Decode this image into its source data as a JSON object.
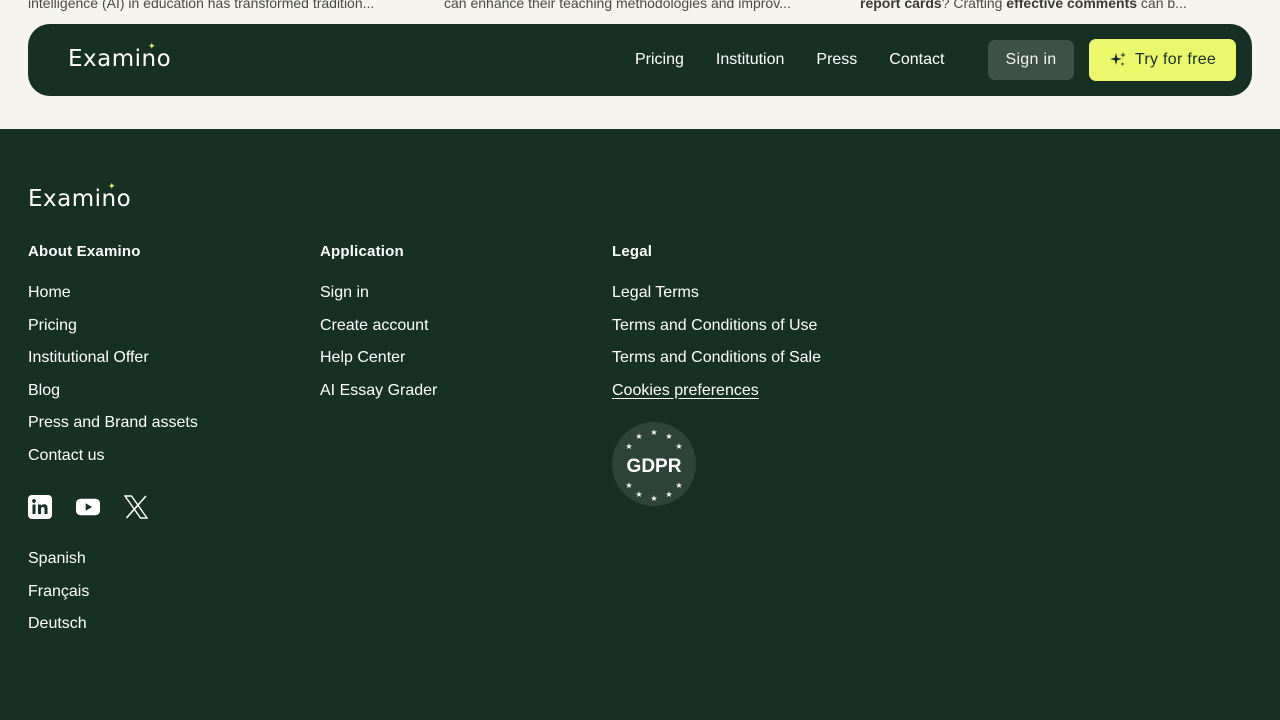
{
  "top_snippets": {
    "left": "intelligence (AI) in education has transformed tradition...",
    "middle": "can enhance their teaching methodologies and improv...",
    "right_bold1": "report cards",
    "right_mid": "? Crafting ",
    "right_bold2": "effective comments",
    "right_end": " can b..."
  },
  "brand": {
    "name": "Examino",
    "accent": "#ecf86b",
    "bg": "#163024"
  },
  "header": {
    "nav": [
      "Pricing",
      "Institution",
      "Press",
      "Contact"
    ],
    "signin_label": "Sign in",
    "try_label": "Try for free"
  },
  "footer": {
    "about": {
      "title": "About Examino",
      "links": [
        "Home",
        "Pricing",
        "Institutional Offer",
        "Blog",
        "Press and Brand assets",
        "Contact us"
      ]
    },
    "application": {
      "title": "Application",
      "links": [
        "Sign in",
        "Create account",
        "Help Center",
        "AI Essay Grader"
      ]
    },
    "legal": {
      "title": "Legal",
      "links": [
        "Legal Terms",
        "Terms and Conditions of Use",
        "Terms and Conditions of Sale",
        "Cookies preferences"
      ]
    },
    "social": [
      "linkedin-icon",
      "youtube-icon",
      "x-icon"
    ],
    "languages": [
      "Spanish",
      "Français",
      "Deutsch"
    ],
    "gdpr_label": "GDPR"
  }
}
